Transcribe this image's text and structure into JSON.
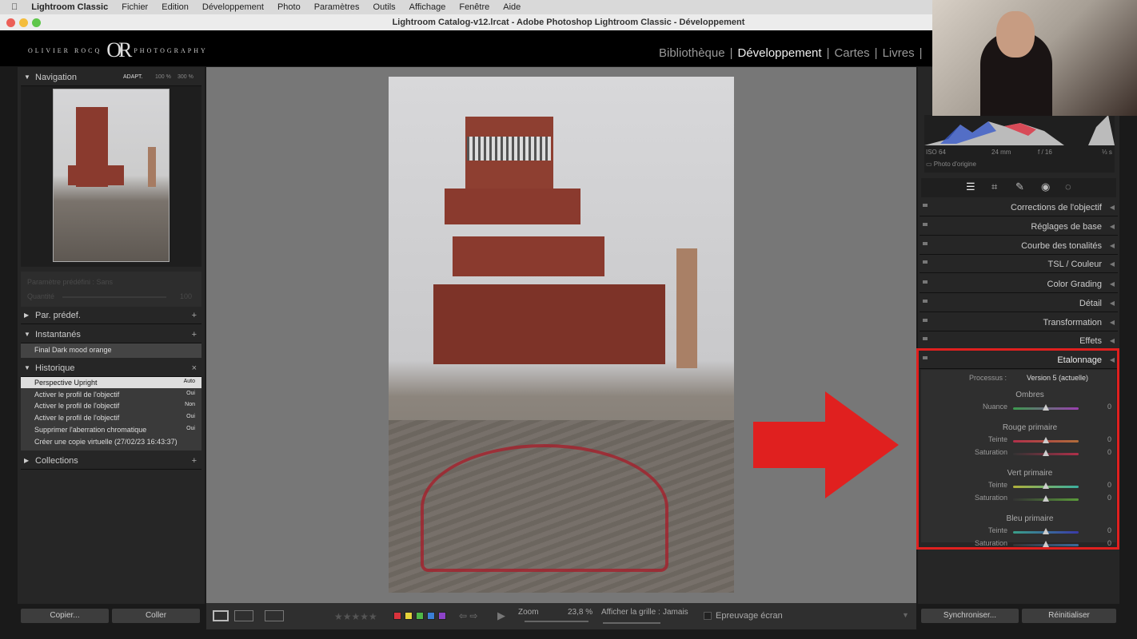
{
  "menubar": {
    "app": "Lightroom Classic",
    "items": [
      "Fichier",
      "Edition",
      "Développement",
      "Photo",
      "Paramètres",
      "Outils",
      "Affichage",
      "Fenêtre",
      "Aide"
    ]
  },
  "window": {
    "title": "Lightroom Catalog-v12.lrcat - Adobe Photoshop Lightroom Classic - Développement"
  },
  "identity": {
    "left": "OLIVIER ROCQ",
    "mono": "OR",
    "right": "PHOTOGRAPHY"
  },
  "modules": [
    "Bibliothèque",
    "Développement",
    "Cartes",
    "Livres"
  ],
  "left": {
    "navigation": {
      "title": "Navigation",
      "zoom_opts": [
        "ADAPT.",
        "100 %",
        "300 %"
      ]
    },
    "preset": {
      "label": "Paramètre prédéfini : Sans",
      "amount_label": "Quantité",
      "amount": "100"
    },
    "presets_title": "Par. prédef.",
    "snapshots": {
      "title": "Instantanés",
      "items": [
        "Final Dark mood orange"
      ]
    },
    "history": {
      "title": "Historique",
      "items": [
        {
          "name": "Perspective Upright",
          "value": "Auto"
        },
        {
          "name": "Activer le profil de l'objectif",
          "value": "Oui"
        },
        {
          "name": "Activer le profil de l'objectif",
          "value": "Non"
        },
        {
          "name": "Activer le profil de l'objectif",
          "value": "Oui"
        },
        {
          "name": "Supprimer l'aberration chromatique",
          "value": "Oui"
        },
        {
          "name": "Créer une copie virtuelle (27/02/23 16:43:37)",
          "value": ""
        }
      ]
    },
    "collections_title": "Collections",
    "copy": "Copier...",
    "paste": "Coller"
  },
  "right": {
    "histogram": {
      "iso": "ISO 64",
      "focal": "24 mm",
      "aperture": "f / 16",
      "shutter": "⅓ s",
      "original": "Photo d'origine"
    },
    "sections": [
      "Corrections de l'objectif",
      "Réglages de base",
      "Courbe des tonalités",
      "TSL / Couleur",
      "Color Grading",
      "Détail",
      "Transformation",
      "Effets"
    ],
    "calibration": {
      "title": "Etalonnage",
      "process_label": "Processus :",
      "process": "Version 5 (actuelle)",
      "groups": [
        {
          "title": "Ombres",
          "sliders": [
            {
              "label": "Nuance",
              "value": "0"
            }
          ]
        },
        {
          "title": "Rouge primaire",
          "sliders": [
            {
              "label": "Teinte",
              "value": "0"
            },
            {
              "label": "Saturation",
              "value": "0"
            }
          ]
        },
        {
          "title": "Vert primaire",
          "sliders": [
            {
              "label": "Teinte",
              "value": "0"
            },
            {
              "label": "Saturation",
              "value": "0"
            }
          ]
        },
        {
          "title": "Bleu primaire",
          "sliders": [
            {
              "label": "Teinte",
              "value": "0"
            },
            {
              "label": "Saturation",
              "value": "0"
            }
          ]
        }
      ]
    },
    "sync": "Synchroniser...",
    "reset": "Réinitialiser"
  },
  "toolbar": {
    "zoom_label": "Zoom",
    "zoom": "23,8 %",
    "grid_label": "Afficher la grille :",
    "grid": "Jamais",
    "proof": "Epreuvage écran",
    "stars": "★★★★★",
    "colors": [
      "#d9323c",
      "#e5d23a",
      "#4fb848",
      "#3b7fd6",
      "#8d43c9"
    ]
  },
  "accent": "#e0201f"
}
